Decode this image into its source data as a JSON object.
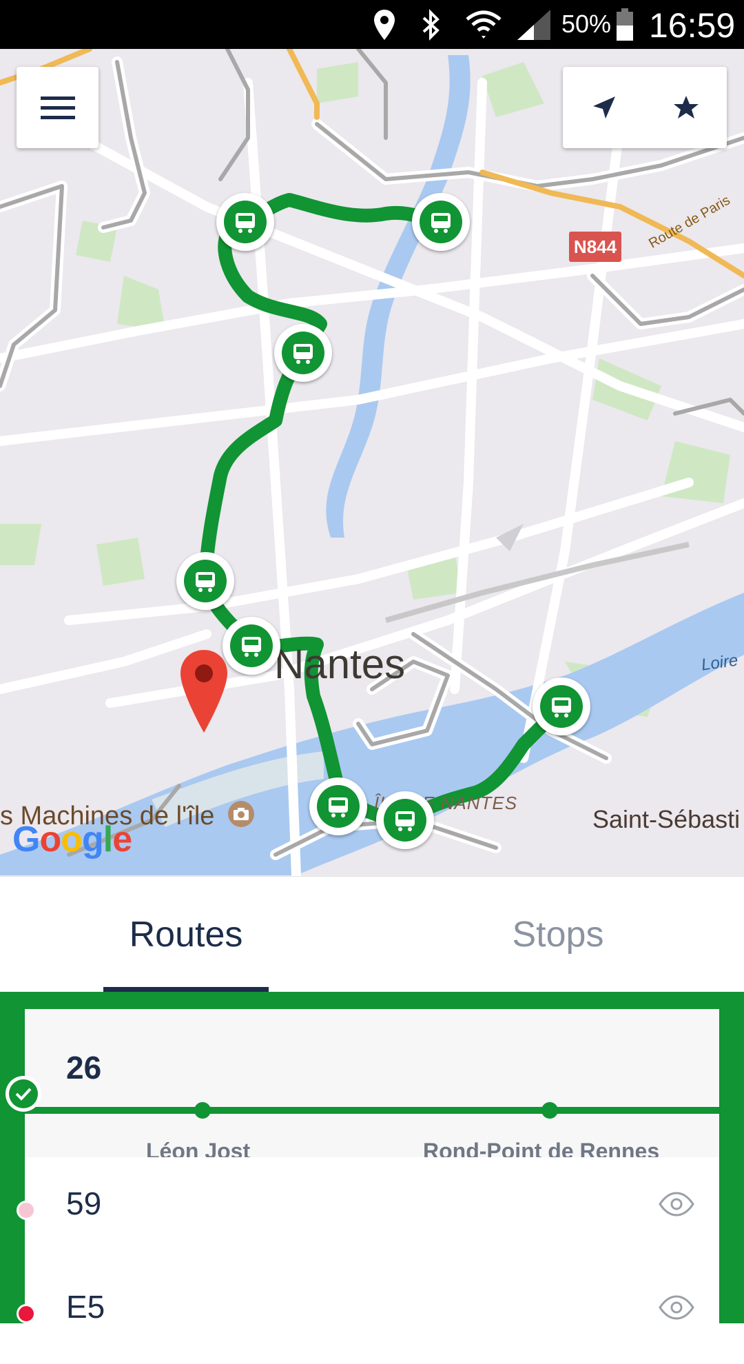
{
  "status_bar": {
    "battery_percent": "50%",
    "time": "16:59",
    "icons": [
      "location-icon",
      "bluetooth-icon",
      "wifi-icon",
      "cell-signal-icon",
      "battery-icon"
    ]
  },
  "map": {
    "city_label": "Nantes",
    "poi_label": "s Machines de l'île",
    "district_label": "ÎLE DE NANTES",
    "town_label": "Saint-Sébasti",
    "river_label": "Loire",
    "road_label": "Route de Paris",
    "road_badge": "N844",
    "attribution": [
      "G",
      "o",
      "o",
      "g",
      "l",
      "e"
    ],
    "route_color": "#119433",
    "pin_color": "#ea4335"
  },
  "toolbar": {
    "menu_icon": "menu-icon",
    "locate_icon": "navigation-arrow-icon",
    "favorites_icon": "star-icon"
  },
  "tabs": [
    {
      "label": "Routes",
      "selected": true
    },
    {
      "label": "Stops",
      "selected": false
    }
  ],
  "routes": {
    "selected": {
      "number": "26",
      "stops": [
        "Léon Jost",
        "Rond-Point de Rennes"
      ]
    },
    "list": [
      {
        "number": "59",
        "dot_color": "#f6c7d3",
        "icon": "eye-icon"
      },
      {
        "number": "E5",
        "dot_color": "#e8173b",
        "icon": "eye-icon"
      }
    ]
  },
  "colors": {
    "primary_dark": "#1d2c49",
    "accent_green": "#119433",
    "inactive_tab": "#8b93a1"
  }
}
